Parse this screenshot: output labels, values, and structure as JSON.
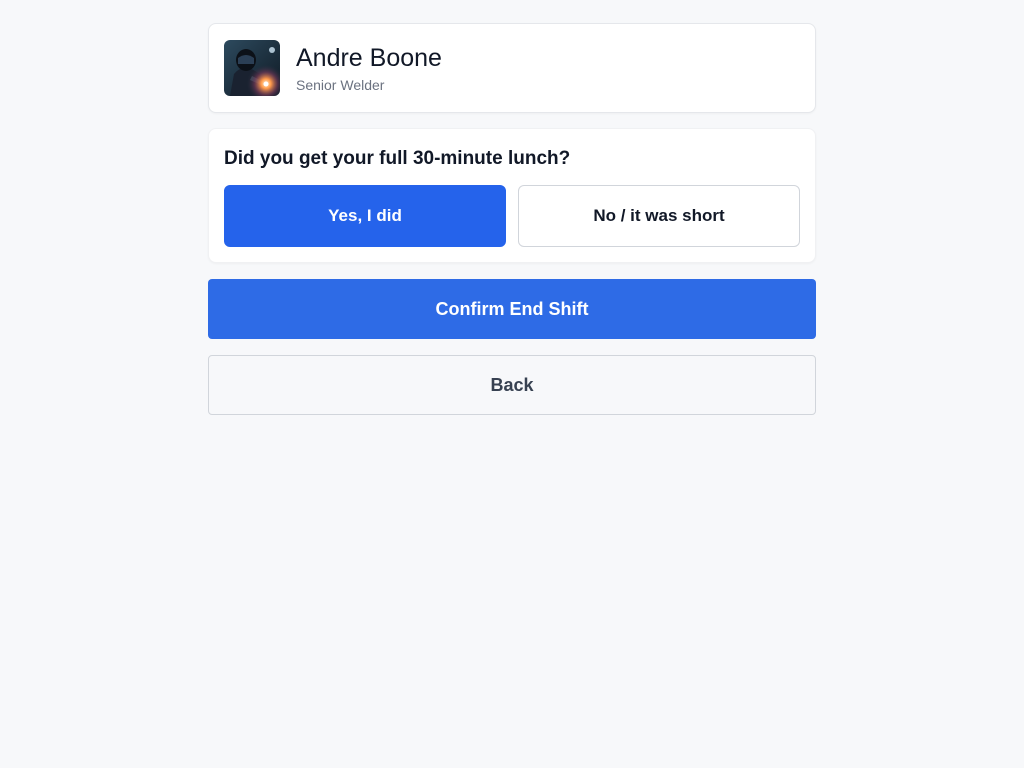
{
  "profile": {
    "name": "Andre Boone",
    "role": "Senior Welder",
    "avatar_icon": "welder-photo"
  },
  "lunch_question": {
    "prompt": "Did you get your full 30-minute lunch?",
    "yes_label": "Yes, I did",
    "no_label": "No / it was short",
    "selected": "yes"
  },
  "actions": {
    "confirm_label": "Confirm End Shift",
    "back_label": "Back"
  },
  "colors": {
    "accent": "#2563eb",
    "background": "#f7f8fa"
  }
}
